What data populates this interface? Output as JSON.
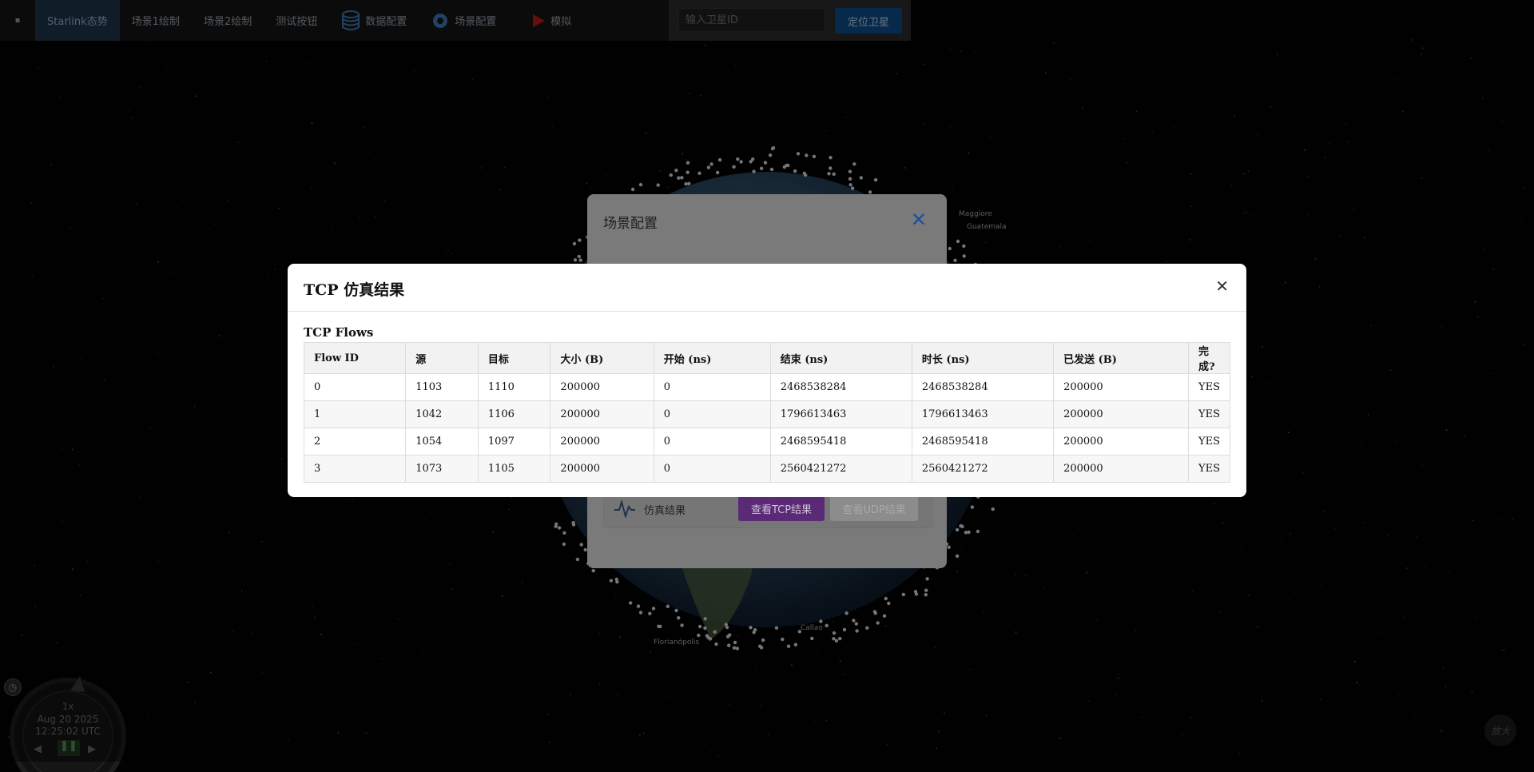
{
  "toolbar": {
    "home_label": "▪",
    "items": [
      {
        "label": "Starlink态势"
      },
      {
        "label": "场景1绘制"
      },
      {
        "label": "场景2绘制"
      },
      {
        "label": "测试按钮"
      },
      {
        "label": "数据配置",
        "icon": "database-icon"
      },
      {
        "label": "场景配置",
        "icon": "gear-icon"
      },
      {
        "label": "模拟",
        "icon": "play-icon"
      }
    ],
    "satellite_input_placeholder": "输入卫星ID",
    "locate_label": "定位卫星",
    "accent_color": "#0c4c8a"
  },
  "scene_modal": {
    "title": "场景配置",
    "sim_label": "仿真结果",
    "tcp_button": "查看TCP结果",
    "udp_button": "查看UDP结果"
  },
  "tcp_modal": {
    "title": "TCP 仿真结果",
    "section_title": "TCP Flows",
    "columns": [
      "Flow ID",
      "源",
      "目标",
      "大小 (B)",
      "开始 (ns)",
      "结束 (ns)",
      "时长 (ns)",
      "已发送 (B)",
      "完成?"
    ],
    "rows": [
      [
        "0",
        "1103",
        "1110",
        "200000",
        "0",
        "2468538284",
        "2468538284",
        "200000",
        "YES"
      ],
      [
        "1",
        "1042",
        "1106",
        "200000",
        "0",
        "1796613463",
        "1796613463",
        "200000",
        "YES"
      ],
      [
        "2",
        "1054",
        "1097",
        "200000",
        "0",
        "2468595418",
        "2468595418",
        "200000",
        "YES"
      ],
      [
        "3",
        "1073",
        "1105",
        "200000",
        "0",
        "2560421272",
        "2560421272",
        "200000",
        "YES"
      ]
    ]
  },
  "clock": {
    "speed": "1x",
    "date": "Aug 20 2025",
    "time": "12:25:02 UTC"
  },
  "zoom_label": "放大"
}
